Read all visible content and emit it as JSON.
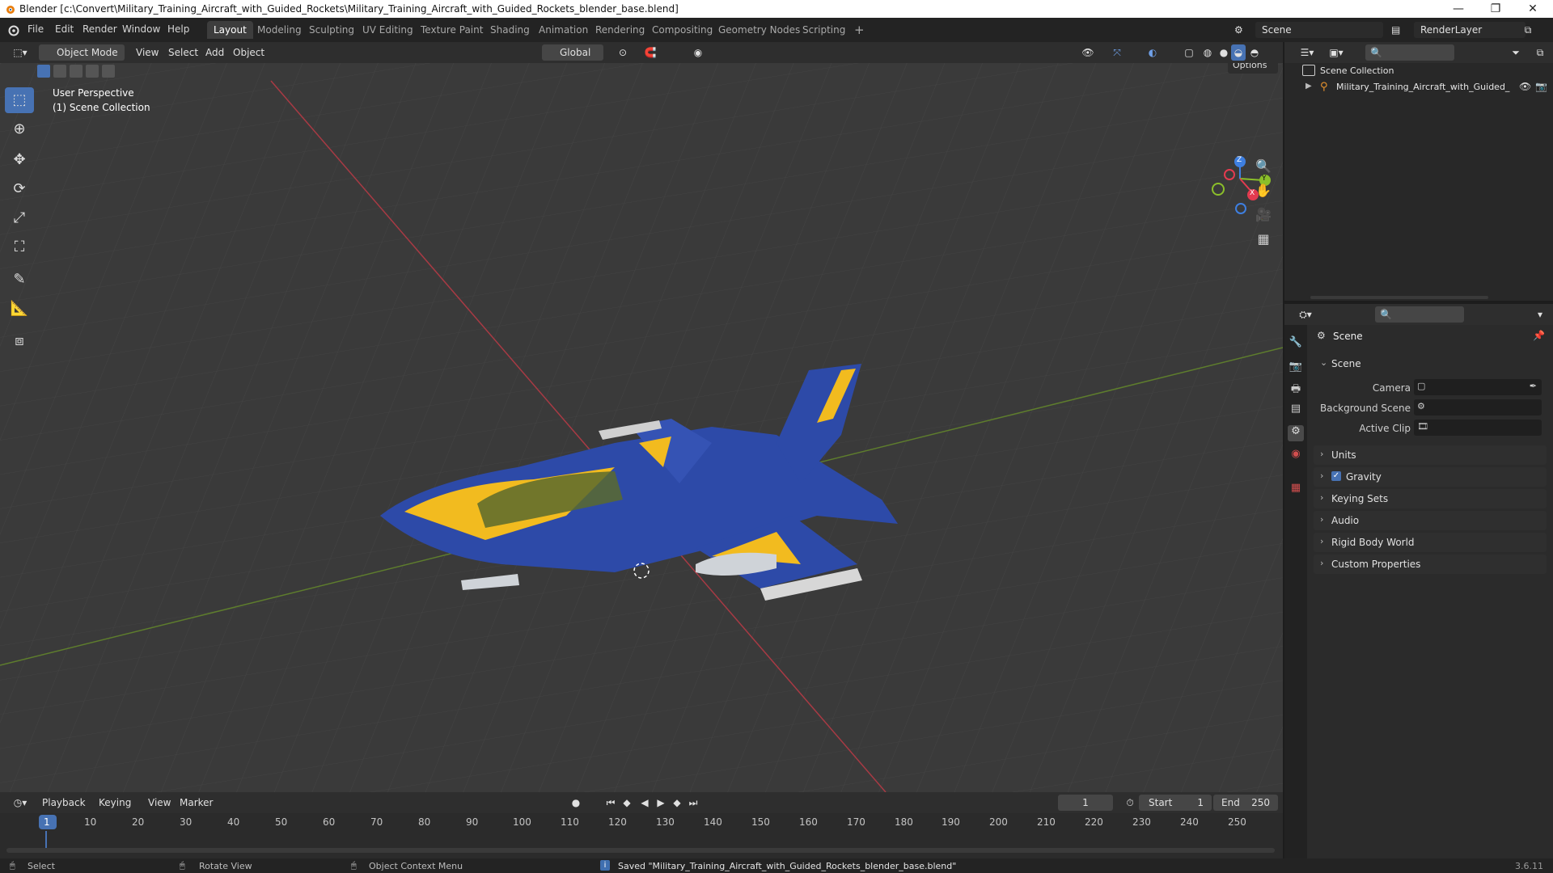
{
  "window": {
    "title": "Blender [c:\\Convert\\Military_Training_Aircraft_with_Guided_Rockets\\Military_Training_Aircraft_with_Guided_Rockets_blender_base.blend]",
    "min": "—",
    "max": "❐",
    "close": "✕"
  },
  "menu": [
    "File",
    "Edit",
    "Render",
    "Window",
    "Help"
  ],
  "workspaces": [
    "Layout",
    "Modeling",
    "Sculpting",
    "UV Editing",
    "Texture Paint",
    "Shading",
    "Animation",
    "Rendering",
    "Compositing",
    "Geometry Nodes",
    "Scripting"
  ],
  "workspace_add": "+",
  "scene_field": "Scene",
  "renderlayer_field": "RenderLayer",
  "viewport_header": {
    "mode": "Object Mode",
    "menus": [
      "View",
      "Select",
      "Add",
      "Object"
    ],
    "transform": "Global",
    "options": "Options"
  },
  "viewport": {
    "perspective": "User Perspective",
    "collection": "(1) Scene Collection",
    "axes": {
      "x": "X",
      "y": "Y",
      "z": "Z"
    }
  },
  "outliner": {
    "root": "Scene Collection",
    "item": "Military_Training_Aircraft_with_Guided_"
  },
  "properties": {
    "context": "Scene",
    "section": "Scene",
    "fields": [
      {
        "label": "Camera"
      },
      {
        "label": "Background Scene"
      },
      {
        "label": "Active Clip"
      }
    ],
    "panels": [
      "Units",
      "Gravity",
      "Keying Sets",
      "Audio",
      "Rigid Body World",
      "Custom Properties"
    ]
  },
  "timeline": {
    "menus": [
      "Playback",
      "Keying",
      "View",
      "Marker"
    ],
    "current_frame": "1",
    "start_label": "Start",
    "start": "1",
    "end_label": "End",
    "end": "250",
    "ruler": [
      "1",
      "10",
      "20",
      "30",
      "40",
      "50",
      "60",
      "70",
      "80",
      "90",
      "100",
      "110",
      "120",
      "130",
      "140",
      "150",
      "160",
      "170",
      "180",
      "190",
      "200",
      "210",
      "220",
      "230",
      "240",
      "250"
    ]
  },
  "status": {
    "select": "Select",
    "rotate": "Rotate View",
    "context_menu": "Object Context Menu",
    "message": "Saved \"Military_Training_Aircraft_with_Guided_Rockets_blender_base.blend\"",
    "version": "3.6.11"
  },
  "colors": {
    "accent": "#4772b3",
    "x_axis": "#e33b4f",
    "y_axis": "#8bbf2a",
    "z_axis": "#3e7fe0"
  }
}
